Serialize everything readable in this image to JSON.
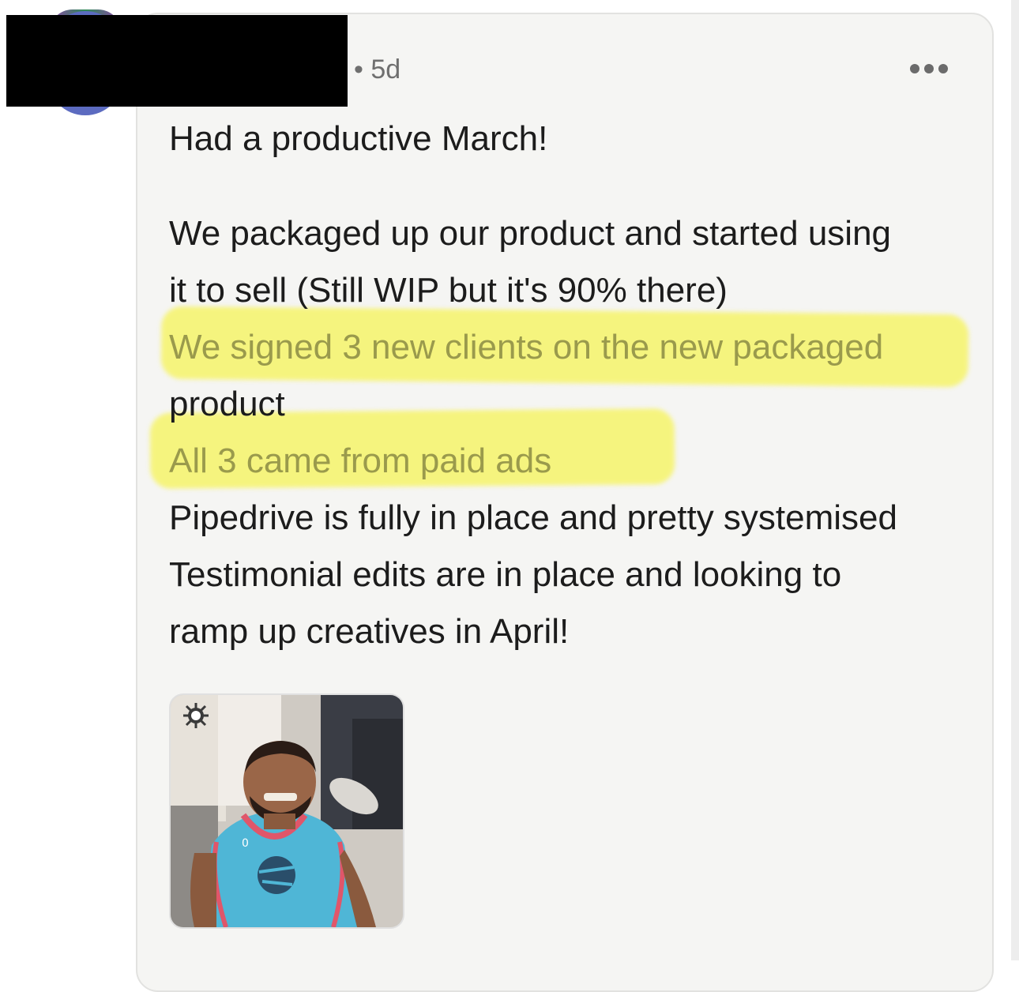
{
  "post": {
    "timestamp": "• 5d",
    "more_label": "more options",
    "lines": [
      "Had a productive March!",
      "We packaged up our product and started using",
      "it to sell (Still WIP but it's 90% there)",
      "We signed 3 new clients on the new packaged",
      "product",
      "All 3 came from paid ads",
      "Pipedrive is fully in place and pretty systemised",
      "Testimonial edits are in place and looking to",
      "ramp up creatives in April!"
    ],
    "highlight_color": "#f6f46a",
    "gif": {
      "icon": "sun-logo-icon",
      "jersey_number": "0"
    }
  }
}
